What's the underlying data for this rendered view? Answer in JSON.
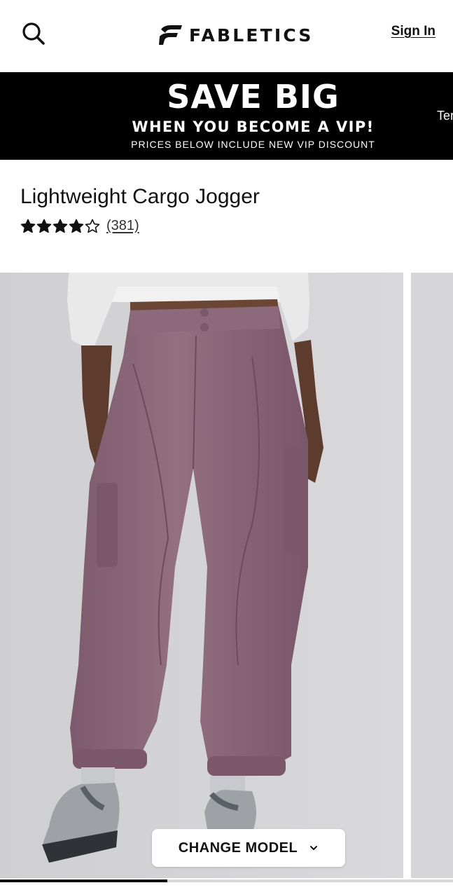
{
  "header": {
    "brand": "FABLETICS",
    "signin_label": "Sign In",
    "search_icon": "search-icon",
    "logo_icon": "fabletics-logo-mark"
  },
  "banner": {
    "title": "SAVE BIG",
    "subtitle": "WHEN YOU BECOME A VIP!",
    "note": "PRICES BELOW INCLUDE NEW VIP DISCOUNT",
    "next_slide_peek": "Ter",
    "background": "#000000",
    "text_color": "#ffffff"
  },
  "product": {
    "title": "Lightweight Cargo Jogger",
    "rating": 4,
    "rating_max": 5,
    "review_count": "(381)",
    "pant_color": "#8a6478"
  },
  "gallery": {
    "change_model_label": "CHANGE MODEL",
    "chevron_icon": "chevron-down-icon",
    "slide_index": 1,
    "progress_fraction": 0.37
  }
}
